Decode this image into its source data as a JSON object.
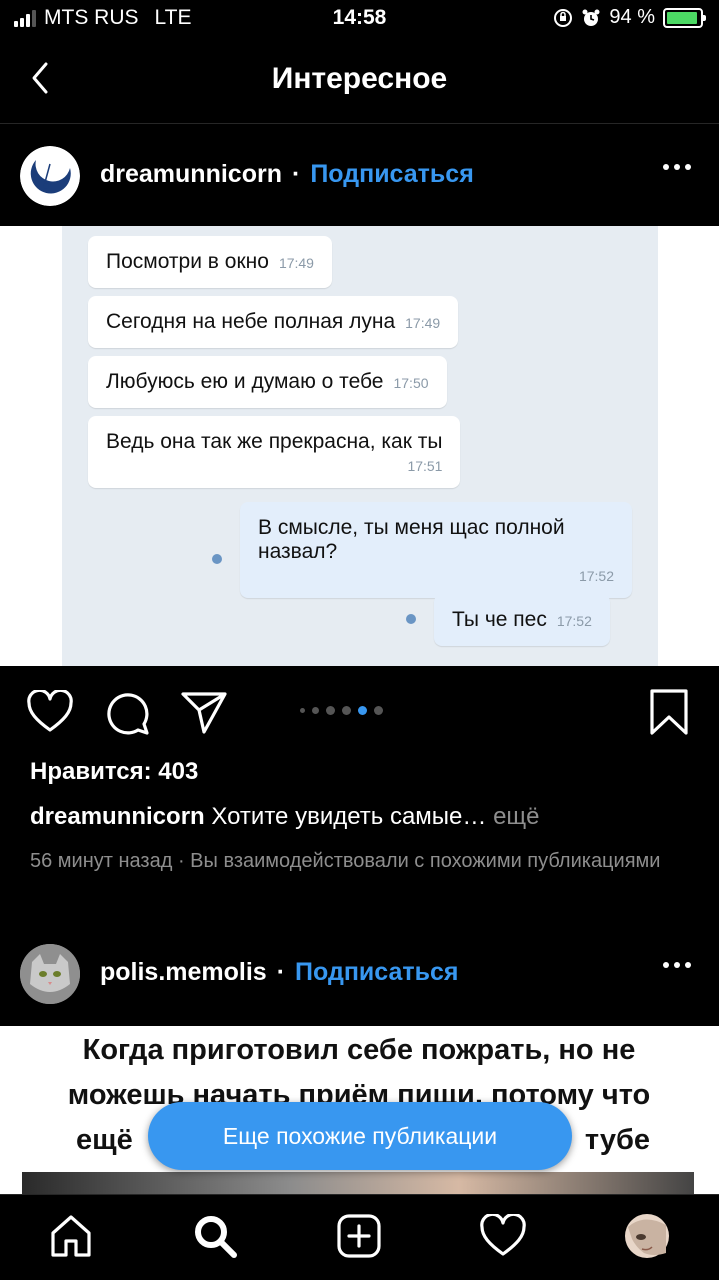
{
  "status_bar": {
    "carrier": "MTS RUS",
    "network": "LTE",
    "time": "14:58",
    "battery": "94 %",
    "battery_level": 0.94
  },
  "nav": {
    "title": "Интересное"
  },
  "post1": {
    "username": "dreamunnicorn",
    "separator": "·",
    "follow_label": "Подписаться",
    "chat": {
      "messages": [
        {
          "text": "Посмотри в окно",
          "time": "17:49",
          "dir": "in"
        },
        {
          "text": "Сегодня на небе полная луна",
          "time": "17:49",
          "dir": "in"
        },
        {
          "text": "Любуюсь ею и думаю о тебе",
          "time": "17:50",
          "dir": "in"
        },
        {
          "text": "Ведь она так же прекрасна, как ты",
          "time": "17:51",
          "dir": "in"
        },
        {
          "text": "В смысле, ты меня щас полной назвал?",
          "time": "17:52",
          "dir": "out"
        },
        {
          "text": "Ты че пес",
          "time": "17:52",
          "dir": "out"
        }
      ]
    },
    "carousel": {
      "count": 6,
      "active_index": 4
    },
    "likes": "Нравится: 403",
    "caption_user": "dreamunnicorn",
    "caption_text": "Хотите увидеть самые…",
    "caption_more": "ещё",
    "meta": "56 минут назад · Вы взаимодействовали с похожими публикациями"
  },
  "post2": {
    "username": "polis.memolis",
    "separator": "·",
    "follow_label": "Подписаться",
    "meme_line1": "Когда приготовил себе пожрать, но не",
    "meme_line2": "можешь начать приём пищи, потому что",
    "meme_line3_left": "ещё",
    "meme_line3_right": "тубе"
  },
  "similar_button": "Еще похожие публикации",
  "colors": {
    "accent": "#3897f0",
    "muted": "#8e8e8e",
    "chat_bg": "#e6ecf2"
  },
  "tabs": [
    {
      "icon": "home-icon"
    },
    {
      "icon": "search-icon"
    },
    {
      "icon": "add-post-icon"
    },
    {
      "icon": "heart-icon"
    },
    {
      "icon": "profile-avatar"
    }
  ]
}
